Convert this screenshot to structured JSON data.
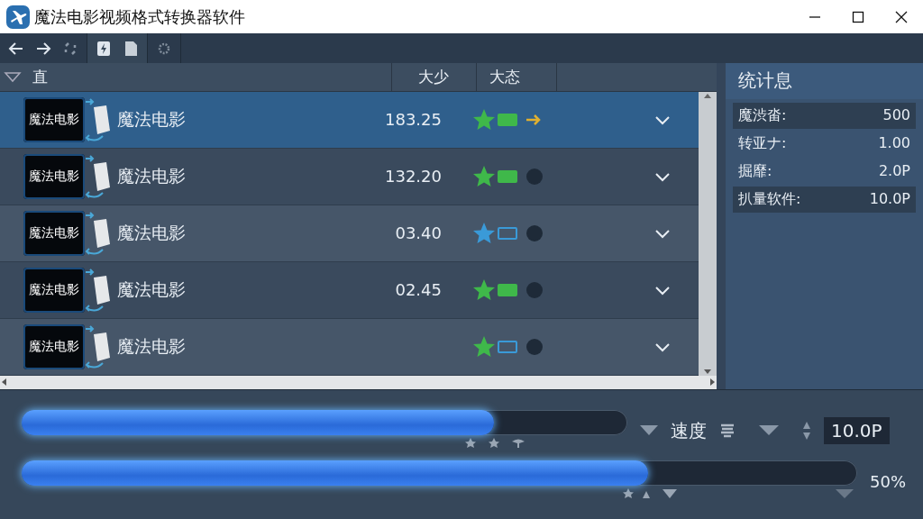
{
  "window": {
    "title": "魔法电影视频格式转换器软件"
  },
  "table": {
    "columns": [
      "直",
      "大少",
      "大态"
    ],
    "rows": [
      {
        "thumbnail_text": "魔法电影",
        "name": "魔法电影",
        "size": "183.25",
        "selected": true,
        "color": "#3fb84a",
        "toggle_on": true,
        "kind": "arrow"
      },
      {
        "thumbnail_text": "魔法电影",
        "name": "魔法电影",
        "size": "132.20",
        "selected": false,
        "color": "#3fb84a",
        "toggle_on": true,
        "kind": "dot"
      },
      {
        "thumbnail_text": "魔法电影",
        "name": "魔法电影",
        "size": "03.40",
        "selected": false,
        "color": "#3a9ad8",
        "toggle_on": false,
        "kind": "dot"
      },
      {
        "thumbnail_text": "魔法电影",
        "name": "魔法电影",
        "size": "02.45",
        "selected": false,
        "color": "#3fb84a",
        "toggle_on": true,
        "kind": "dot"
      },
      {
        "thumbnail_text": "魔法电影",
        "name": "魔法电影",
        "selected": false,
        "color": "#3fb84a",
        "toggle_on": false,
        "kind": "dot"
      }
    ]
  },
  "stats": {
    "title": "统计息",
    "items": [
      {
        "label": "魔渋畓:",
        "value": "500",
        "highlighted": true
      },
      {
        "label": "转亚ナ:",
        "value": "1.00",
        "highlighted": false
      },
      {
        "label": "掘靡:",
        "value": "2.0P",
        "highlighted": false
      },
      {
        "label": "扒量软件:",
        "value": "10.0P",
        "highlighted": true
      }
    ]
  },
  "progress": [
    {
      "level": 0.78
    },
    {
      "level": 0.75,
      "reading": "50%"
    }
  ],
  "speed": {
    "label": "速度",
    "value": "10.0P"
  }
}
